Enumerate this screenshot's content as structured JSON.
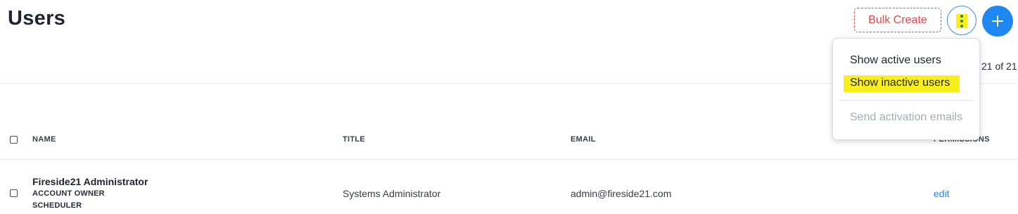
{
  "page": {
    "title": "Users"
  },
  "header": {
    "bulk_create_label": "Bulk Create",
    "more_icon": "vertical-ellipsis",
    "add_icon": "plus"
  },
  "pagination": {
    "count_text": "21 of 21"
  },
  "table": {
    "columns": [
      "NAME",
      "TITLE",
      "EMAIL",
      "PERMISSIONS"
    ],
    "rows": [
      {
        "name": "Fireside21 Administrator",
        "roles": [
          "ACCOUNT OWNER",
          "SCHEDULER"
        ],
        "title": "Systems Administrator",
        "email": "admin@fireside21.com",
        "action": "edit"
      }
    ]
  },
  "menu": {
    "items": [
      {
        "label": "Show active users",
        "enabled": true,
        "highlighted": false
      },
      {
        "label": "Show inactive users",
        "enabled": true,
        "highlighted": true
      },
      {
        "label": "Send activation emails",
        "enabled": false,
        "highlighted": false
      }
    ]
  },
  "colors": {
    "accent_blue": "#1e88f0",
    "danger_red": "#e2474d",
    "highlight_yellow": "#f8ef1c"
  }
}
